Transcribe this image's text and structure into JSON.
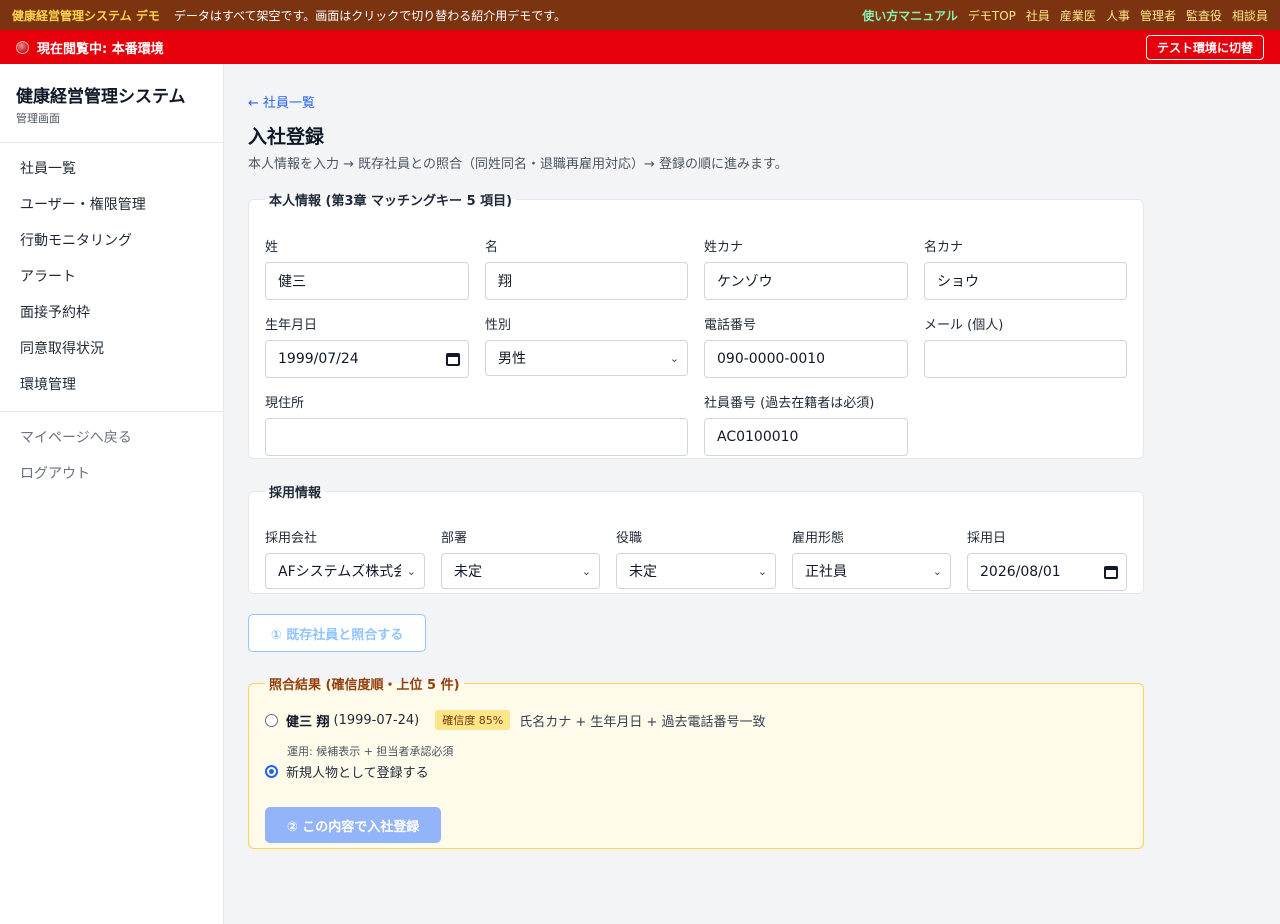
{
  "demo_bar": {
    "brand": "健康経営管理システム デモ",
    "note": "データはすべて架空です。画面はクリックで切り替わる紹介用デモです。",
    "manual": "使い方マニュアル",
    "links": [
      "デモTOP",
      "社員",
      "産業医",
      "人事",
      "管理者",
      "監査役",
      "相談員"
    ]
  },
  "env_bar": {
    "status": "現在閲覧中: 本番環境",
    "switch_button": "テスト環境に切替"
  },
  "sidebar": {
    "app_name": "健康経営管理システム",
    "app_sub": "管理画面",
    "items": [
      "社員一覧",
      "ユーザー・権限管理",
      "行動モニタリング",
      "アラート",
      "面接予約枠",
      "同意取得状況",
      "環境管理"
    ],
    "secondary": [
      "マイページへ戻る",
      "ログアウト"
    ]
  },
  "main": {
    "back_link": "← 社員一覧",
    "title": "入社登録",
    "description": "本人情報を入力 → 既存社員との照合（同姓同名・退職再雇用対応）→ 登録の順に進みます。"
  },
  "personal": {
    "legend": "本人情報 (第3章 マッチングキー 5 項目)",
    "last_name": {
      "label": "姓",
      "value": "健三"
    },
    "first_name": {
      "label": "名",
      "value": "翔"
    },
    "last_kana": {
      "label": "姓カナ",
      "value": "ケンゾウ"
    },
    "first_kana": {
      "label": "名カナ",
      "value": "ショウ"
    },
    "birthdate": {
      "label": "生年月日",
      "value": "1999/07/24"
    },
    "gender": {
      "label": "性別",
      "value": "男性"
    },
    "phone": {
      "label": "電話番号",
      "value": "090-0000-0010"
    },
    "email": {
      "label": "メール (個人)",
      "value": ""
    },
    "address": {
      "label": "現住所",
      "value": ""
    },
    "employee_no": {
      "label": "社員番号 (過去在籍者は必須)",
      "value": "AC0100010"
    }
  },
  "hiring": {
    "legend": "採用情報",
    "company": {
      "label": "採用会社",
      "value": "AFシステムズ株式会社"
    },
    "department": {
      "label": "部署",
      "value": "未定"
    },
    "position": {
      "label": "役職",
      "value": "未定"
    },
    "employment_type": {
      "label": "雇用形態",
      "value": "正社員"
    },
    "hire_date": {
      "label": "採用日",
      "value": "2026/08/01"
    }
  },
  "match_button": "① 既存社員と照合する",
  "results": {
    "legend": "照合結果 (確信度順・上位 5 件)",
    "candidate": {
      "name": "健三 翔",
      "dob": "(1999-07-24)",
      "confidence": "確信度 85%",
      "reason": "氏名カナ + 生年月日 + 過去電話番号一致",
      "note": "運用: 候補表示 + 担当者承認必須"
    },
    "new_person": "新規人物として登録する",
    "register_button": "② この内容で入社登録"
  },
  "colors": {
    "demo_bar": "#7c3410",
    "env_bar": "#e5000b",
    "link": "#2563eb",
    "badge": "#fde68a"
  }
}
